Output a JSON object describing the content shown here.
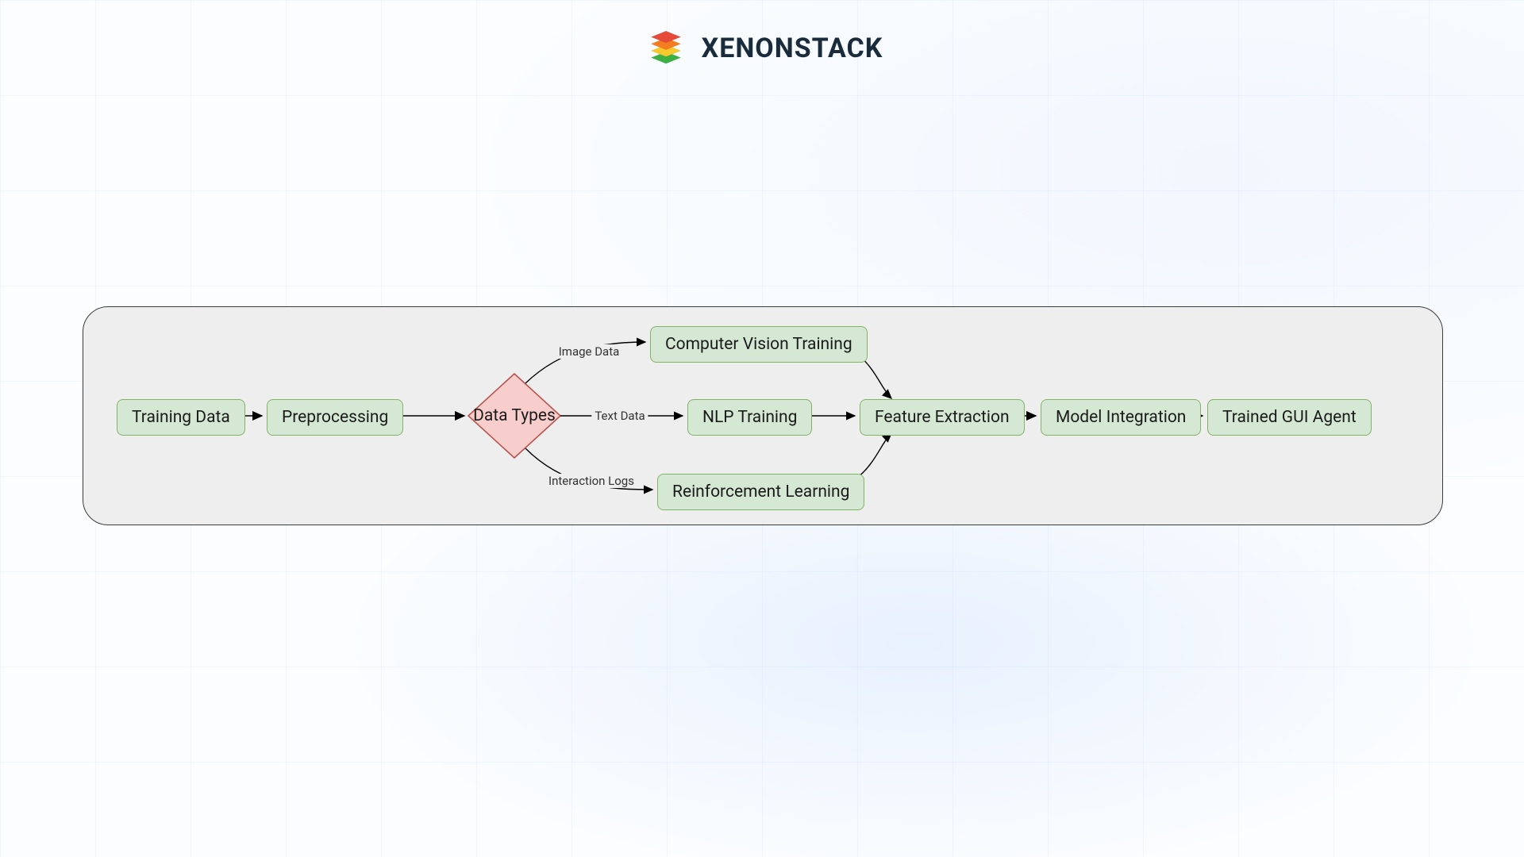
{
  "brand": {
    "name": "XENONSTACK"
  },
  "nodes": {
    "training_data": "Training Data",
    "preprocessing": "Preprocessing",
    "data_types": "Data Types",
    "cv_training": "Computer Vision Training",
    "nlp_training": "NLP Training",
    "rl": "Reinforcement Learning",
    "feat_extract": "Feature Extraction",
    "model_integ": "Model Integration",
    "trained_agent": "Trained GUI Agent"
  },
  "edges": {
    "image_data": "Image Data",
    "text_data": "Text Data",
    "interaction_logs": "Interaction Logs"
  },
  "colors": {
    "process_fill": "#d5e8d4",
    "process_stroke": "#82b366",
    "decision_fill": "#f8cecc",
    "decision_stroke": "#b85450",
    "panel_fill": "#eeeeee",
    "panel_stroke": "#3b3b3b"
  }
}
